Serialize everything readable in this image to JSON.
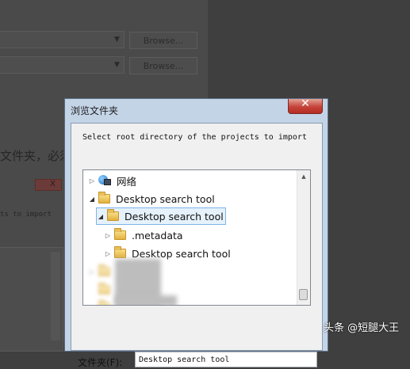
{
  "background": {
    "browse_button_label": "Browse...",
    "label_text": "文件夹，必须是文",
    "red_button_label": "X",
    "mono_text": "ts to import"
  },
  "dialog": {
    "title": "浏览文件夹",
    "close_glyph": "✕",
    "instruction": "Select root directory of the projects to import",
    "tree": {
      "items": [
        {
          "label": "网络",
          "icon": "network-icon",
          "expanded": false
        },
        {
          "label": "Desktop search tool",
          "icon": "folder-icon",
          "expanded": true
        },
        {
          "label": "Desktop search tool",
          "icon": "folder-icon",
          "expanded": true,
          "selected": true
        },
        {
          "label": ".metadata",
          "icon": "folder-icon",
          "expanded": false
        },
        {
          "label": "Desktop search tool",
          "icon": "folder-icon",
          "expanded": false
        }
      ]
    },
    "folder_field": {
      "label": "文件夹(F):",
      "value": "Desktop search tool"
    }
  },
  "watermark": "头条 @短腿大王"
}
